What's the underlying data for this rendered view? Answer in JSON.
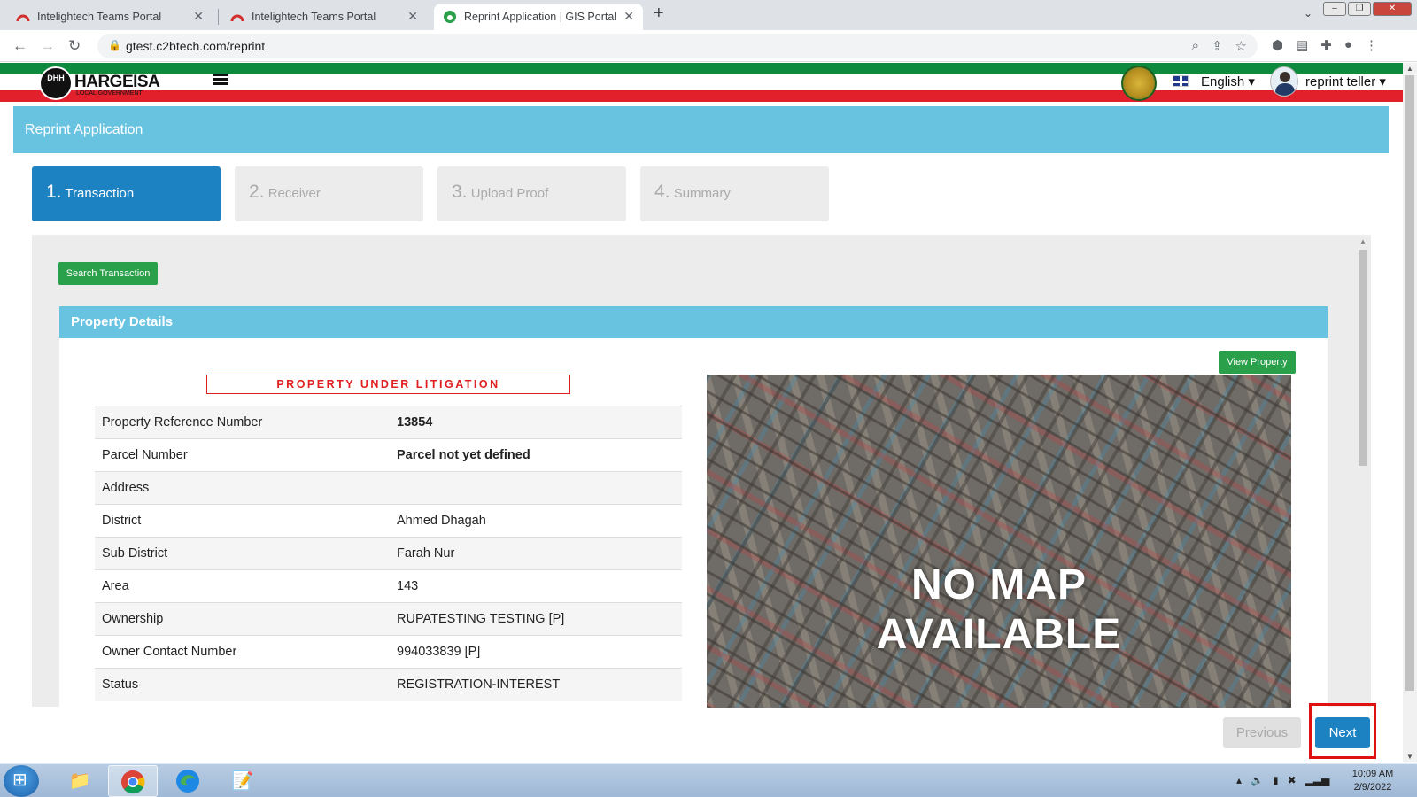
{
  "browser": {
    "tabs": [
      {
        "title": "Intelightech Teams Portal",
        "active": false
      },
      {
        "title": "Intelightech Teams Portal",
        "active": false
      },
      {
        "title": "Reprint Application | GIS Portal",
        "active": true
      }
    ],
    "url": "gtest.c2btech.com/reprint"
  },
  "header": {
    "logo_text": "HARGEISA",
    "logo_sub": "LOCAL GOVERNMENT",
    "logo_badge": "DHH",
    "language": "English",
    "user": "reprint teller"
  },
  "panel": {
    "title": "Reprint Application",
    "steps": [
      {
        "num": "1.",
        "label": "Transaction",
        "active": true
      },
      {
        "num": "2.",
        "label": "Receiver",
        "active": false
      },
      {
        "num": "3.",
        "label": "Upload Proof",
        "active": false
      },
      {
        "num": "4.",
        "label": "Summary",
        "active": false
      }
    ],
    "search_button": "Search Transaction",
    "property_section_title": "Property Details",
    "view_property_button": "View Property",
    "litigation_notice": "PROPERTY UNDER LITIGATION",
    "details": [
      {
        "key": "Property Reference Number",
        "value": "13854",
        "bold": true
      },
      {
        "key": "Parcel Number",
        "value": "Parcel not yet defined",
        "bold": true
      },
      {
        "key": "Address",
        "value": "",
        "bold": false
      },
      {
        "key": "District",
        "value": "Ahmed Dhagah",
        "bold": false
      },
      {
        "key": "Sub District",
        "value": "Farah Nur",
        "bold": false
      },
      {
        "key": "Area",
        "value": "143",
        "bold": false
      },
      {
        "key": "Ownership",
        "value": "RUPATESTING TESTING [P]",
        "bold": false
      },
      {
        "key": "Owner Contact Number",
        "value": "994033839 [P]",
        "bold": false
      },
      {
        "key": "Status",
        "value": "REGISTRATION-INTEREST",
        "bold": false
      }
    ],
    "map_overlay_line1": "NO MAP",
    "map_overlay_line2": "AVAILABLE",
    "previous_button": "Previous",
    "next_button": "Next"
  },
  "taskbar": {
    "time": "10:09 AM",
    "date": "2/9/2022"
  },
  "colors": {
    "accent": "#1d82c2",
    "panel_header": "#68c3e0",
    "success": "#2aa04a",
    "danger": "#e02020"
  }
}
